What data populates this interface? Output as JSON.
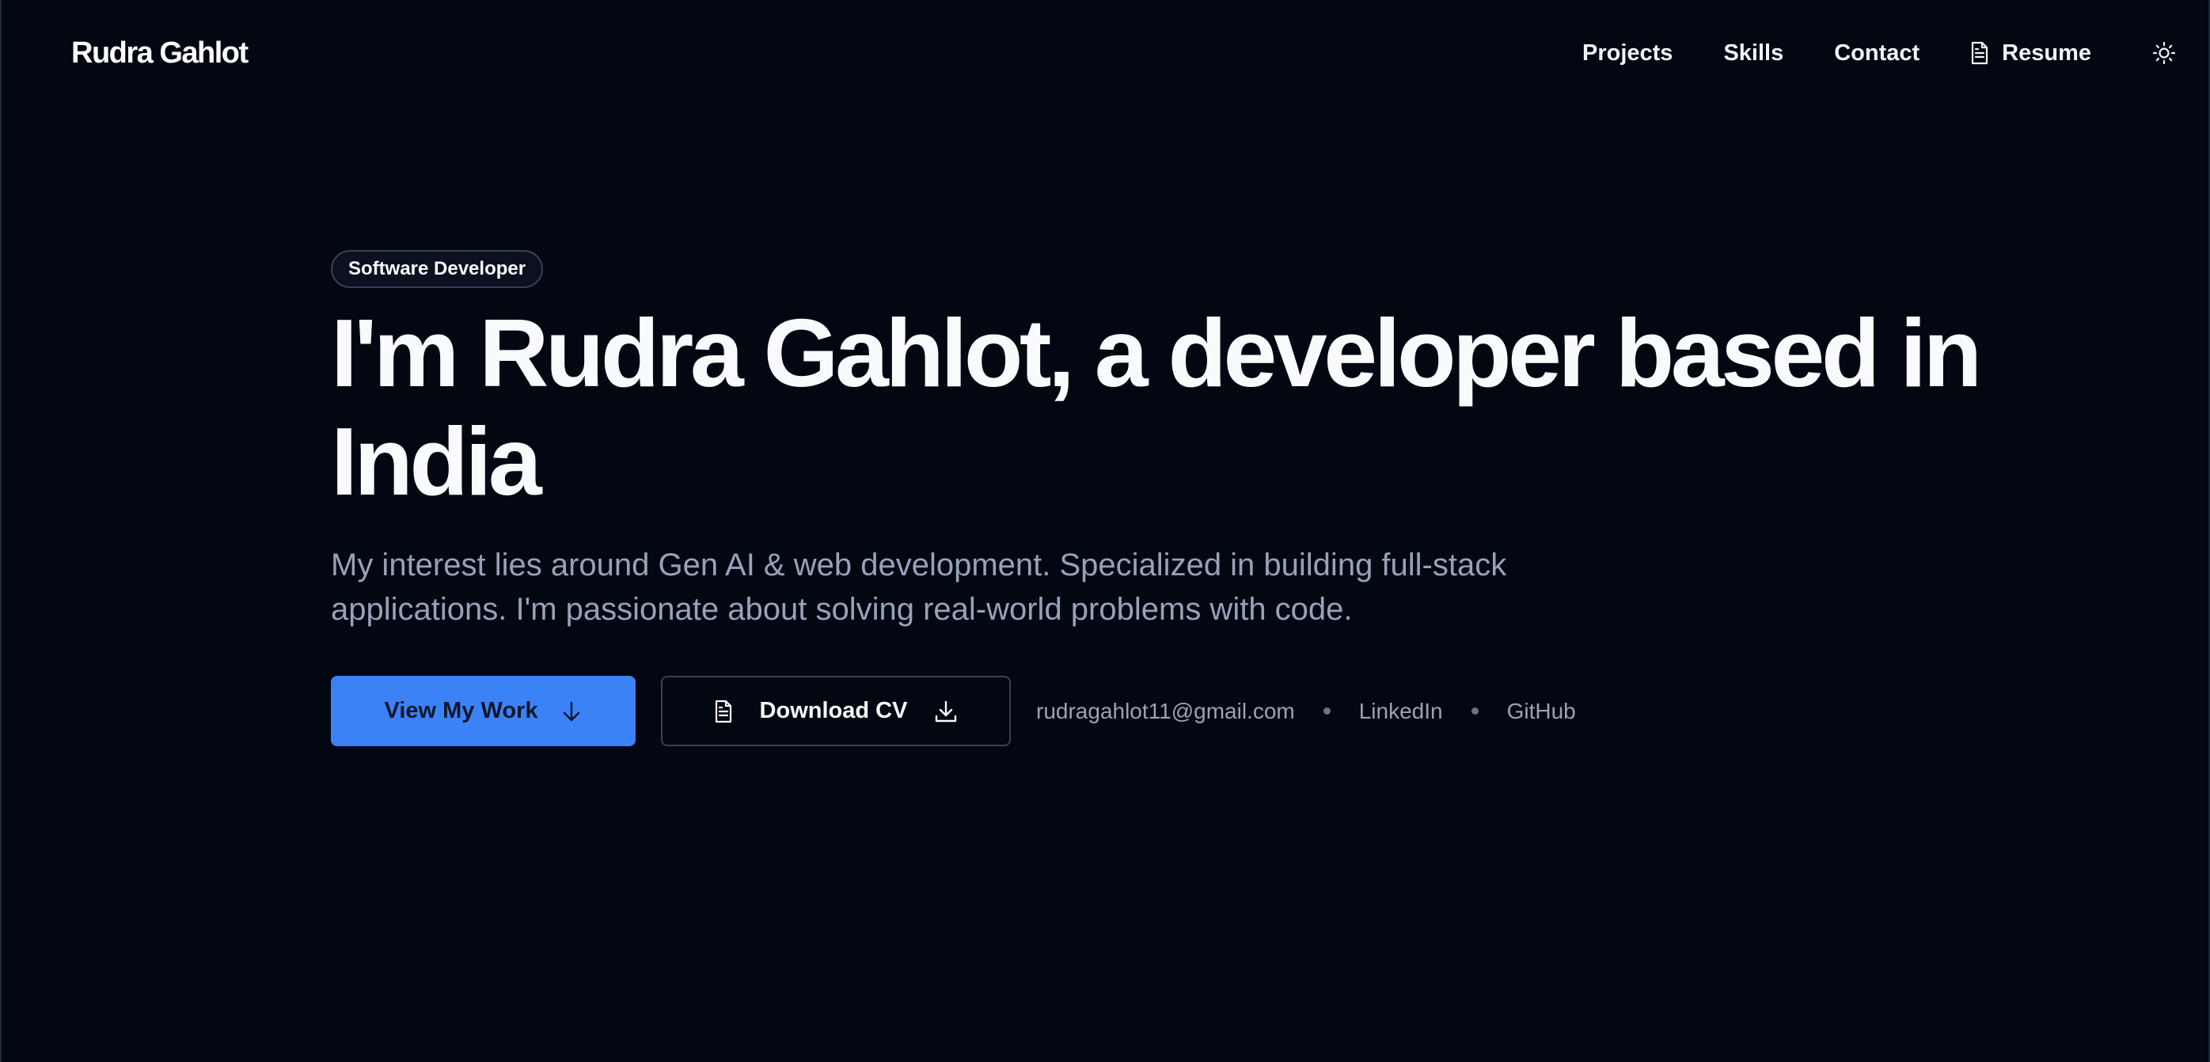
{
  "header": {
    "brand": "Rudra Gahlot",
    "nav": {
      "projects": "Projects",
      "skills": "Skills",
      "contact": "Contact",
      "resume": "Resume"
    },
    "icons": {
      "resume": "file-text-icon",
      "theme_toggle": "sun-icon"
    }
  },
  "hero": {
    "badge": "Software Developer",
    "headline": "I'm Rudra Gahlot, a developer based in India",
    "subtext": "My interest lies around Gen AI & web development. Specialized in building full-stack applications. I'm passionate about solving real-world problems with code.",
    "primary_button": {
      "label": "View My Work",
      "icon": "arrow-down-icon"
    },
    "secondary_button": {
      "label": "Download CV",
      "icon_left": "file-text-icon",
      "icon_right": "download-icon"
    },
    "contact": {
      "email": "rudragahlot11@gmail.com",
      "linkedin": "LinkedIn",
      "github": "GitHub"
    }
  },
  "colors": {
    "background": "#030712",
    "accent": "#3b82f6",
    "muted_text": "#94a3b8",
    "border": "#374151"
  }
}
